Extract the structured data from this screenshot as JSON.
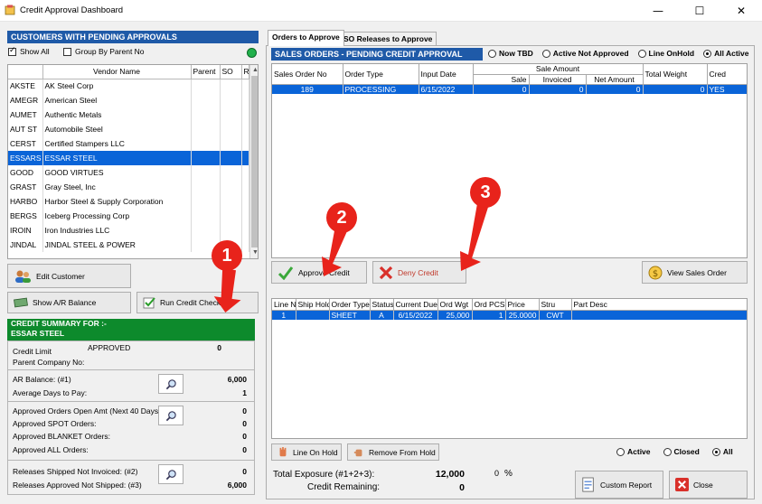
{
  "window": {
    "title": "Credit Approval Dashboard"
  },
  "left": {
    "header": "CUSTOMERS WITH PENDING APPROVALS",
    "show_all_label": "Show All",
    "group_by_label": "Group By Parent No",
    "columns": [
      "",
      "Vendor Name",
      "Parent",
      "SO",
      "R"
    ],
    "vendors": [
      {
        "code": "AKSTE",
        "name": "AK Steel Corp"
      },
      {
        "code": "AMEGR",
        "name": "American Steel"
      },
      {
        "code": "AUMET",
        "name": "Authentic Metals"
      },
      {
        "code": "AUT ST",
        "name": "Automobile Steel"
      },
      {
        "code": "CERST",
        "name": "Certified Stampers LLC"
      },
      {
        "code": "ESSARS",
        "name": "ESSAR STEEL"
      },
      {
        "code": "GOOD",
        "name": "GOOD VIRTUES"
      },
      {
        "code": "GRAST",
        "name": "Gray Steel, Inc"
      },
      {
        "code": "HARBO",
        "name": "Harbor Steel & Supply Corporation"
      },
      {
        "code": "BERGS",
        "name": "Iceberg Processing Corp"
      },
      {
        "code": "IROIN",
        "name": "Iron Industries LLC"
      },
      {
        "code": "JINDAL",
        "name": "JINDAL STEEL & POWER"
      }
    ],
    "selected_index": 5,
    "edit_customer_label": "Edit Customer",
    "show_ar_label": "Show A/R Balance",
    "run_credit_label": "Run Credit Check"
  },
  "summary": {
    "header_line1": "CREDIT SUMMARY FOR :-",
    "header_line2": "ESSAR STEEL",
    "credit_limit_label": "Credit Limit",
    "credit_status": "APPROVED",
    "credit_limit_value": "0",
    "parent_company_label": "Parent Company No:",
    "ar_balance_label": "AR Balance: (#1)",
    "ar_balance_value": "6,000",
    "avg_days_label": "Average Days to Pay:",
    "avg_days_value": "1",
    "approved_open_label": "Approved Orders Open Amt (Next 40 Days):",
    "approved_open_value": "0",
    "approved_spot_label": "Approved SPOT Orders:",
    "approved_spot_value": "0",
    "approved_blanket_label": "Approved BLANKET Orders:",
    "approved_blanket_value": "0",
    "approved_all_label": "Approved ALL Orders:",
    "approved_all_value": "0",
    "releases_shipped_label": "Releases Shipped Not Invoiced: (#2)",
    "releases_shipped_value": "0",
    "releases_approved_label": "Releases Approved Not Shipped: (#3)",
    "releases_approved_value": "6,000"
  },
  "tabs": [
    "Orders to Approve",
    "SO Releases to Approve"
  ],
  "orders": {
    "header": "SALES ORDERS - PENDING CREDIT APPROVAL",
    "filters": [
      "Now TBD",
      "Active Not Approved",
      "Line OnHold",
      "All Active"
    ],
    "filter_selected": 3,
    "sale_amount_group": "Sale Amount",
    "columns": [
      "Sales Order No",
      "Order Type",
      "Input Date",
      "Sale",
      "Invoiced",
      "Net Amount",
      "Total Weight",
      "Cred"
    ],
    "rows": [
      {
        "so": "189",
        "type": "PROCESSING",
        "date": "6/15/2022",
        "sale": "0",
        "invoiced": "0",
        "net": "0",
        "weight": "0",
        "cred": "YES"
      }
    ],
    "approve_label": "Approve Credit",
    "deny_label": "Deny Credit",
    "view_sales_label": "View Sales Order"
  },
  "lines": {
    "columns": [
      "Line N",
      "Ship Hold",
      "Order Type",
      "Status",
      "Current Due",
      "Ord Wgt",
      "Ord PCS",
      "Price",
      "Stru",
      "Part Desc"
    ],
    "rows": [
      {
        "line": "1",
        "hold": "",
        "type": "SHEET",
        "status": "A",
        "due": "6/15/2022",
        "wgt": "25,000",
        "pcs": "1",
        "price": "25.0000",
        "stru": "CWT",
        "desc": ""
      }
    ],
    "line_onhold_label": "Line On Hold",
    "remove_hold_label": "Remove From Hold",
    "filters": [
      "Active",
      "Closed",
      "All"
    ],
    "filter_selected": 2
  },
  "footer": {
    "total_exposure_label": "Total Exposure  (#1+2+3):",
    "total_exposure_value": "12,000",
    "percent_value": "0",
    "percent_sign": "%",
    "credit_remaining_label": "Credit Remaining:",
    "credit_remaining_value": "0",
    "custom_report_label": "Custom Report",
    "close_label": "Close"
  },
  "callouts": [
    "1",
    "2",
    "3"
  ],
  "colors": {
    "header_blue": "#1f5aa8",
    "summary_green": "#0d8a2c",
    "selection": "#0a64d8",
    "callout_red": "#e8231b"
  }
}
